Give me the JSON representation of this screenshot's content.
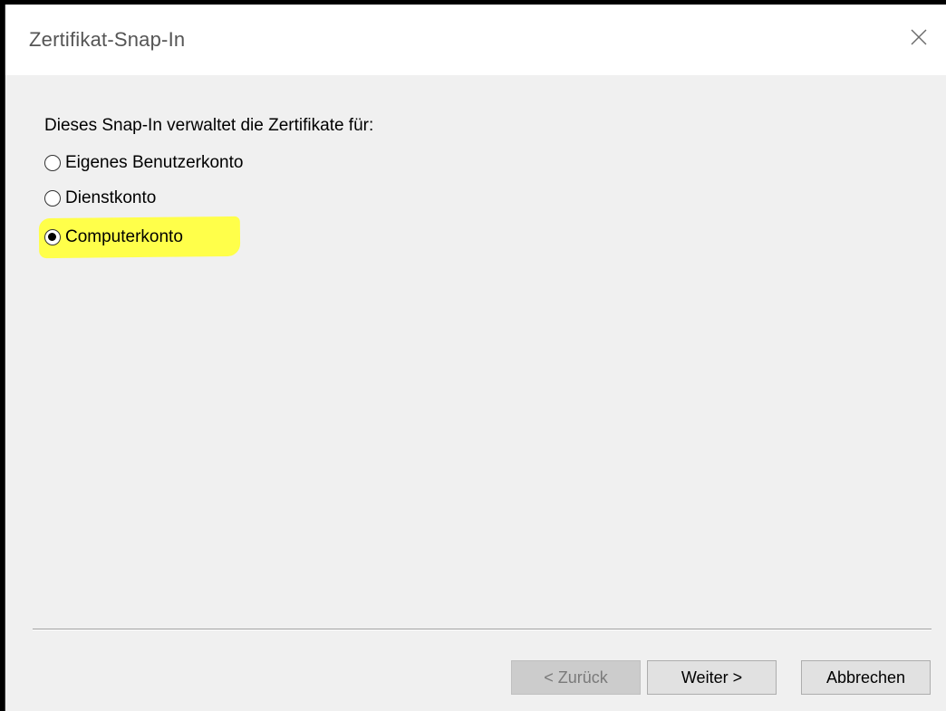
{
  "window": {
    "title": "Zertifikat-Snap-In"
  },
  "content": {
    "prompt": "Dieses Snap-In verwaltet die Zertifikate für:",
    "options": [
      {
        "label": "Eigenes Benutzerkonto",
        "checked": false
      },
      {
        "label": "Dienstkonto",
        "checked": false
      },
      {
        "label": "Computerkonto",
        "checked": true
      }
    ],
    "highlight_color": "#ffff4a"
  },
  "buttons": {
    "back_label": "< Zurück",
    "back_enabled": false,
    "next_label": "Weiter >",
    "cancel_label": "Abbrechen"
  },
  "icons": {
    "close": "close-icon"
  }
}
